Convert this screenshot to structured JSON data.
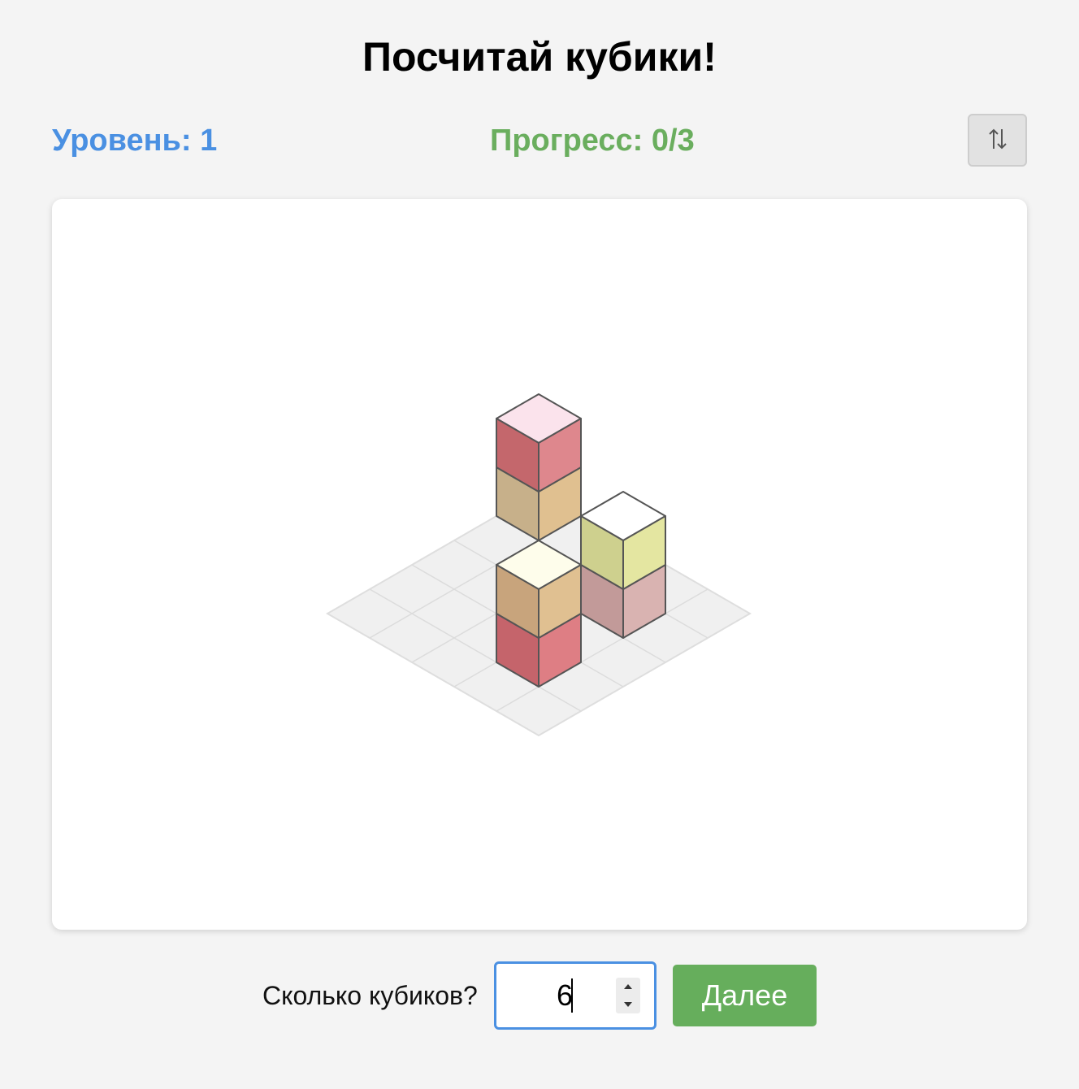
{
  "title": "Посчитай кубики!",
  "status": {
    "level": "Уровень: 1",
    "progress": "Прогресс: 0/3"
  },
  "swap_button_icon": "swap-vertical-icon",
  "scene": {
    "grid_size": 5,
    "cube_count": 6,
    "cubes": [
      {
        "col": 0,
        "row": 0,
        "level": 0,
        "top": "#fde3ee",
        "left": "#c7b08a",
        "right": "#e0c090"
      },
      {
        "col": 0,
        "row": 0,
        "level": 1,
        "top": "#fbe3ec",
        "left": "#c4676c",
        "right": "#de878d"
      },
      {
        "col": 3,
        "row": 1,
        "level": 0,
        "top": "#ffffff",
        "left": "#c29a99",
        "right": "#d9b3b1"
      },
      {
        "col": 3,
        "row": 1,
        "level": 1,
        "top": "#ffffff",
        "left": "#ced08e",
        "right": "#e4e6a1"
      },
      {
        "col": 3,
        "row": 3,
        "level": 0,
        "top": "#fefdeb",
        "left": "#c5646b",
        "right": "#de7e84"
      },
      {
        "col": 3,
        "row": 3,
        "level": 1,
        "top": "#fefdeb",
        "left": "#c8a47c",
        "right": "#e0c091"
      }
    ]
  },
  "answer": {
    "question": "Сколько кубиков?",
    "value": "6"
  },
  "next_label": "Далее",
  "colors": {
    "level": "#4a90e2",
    "progress": "#6aae5e",
    "next_button": "#66ae5c",
    "input_border": "#4a90e2"
  }
}
